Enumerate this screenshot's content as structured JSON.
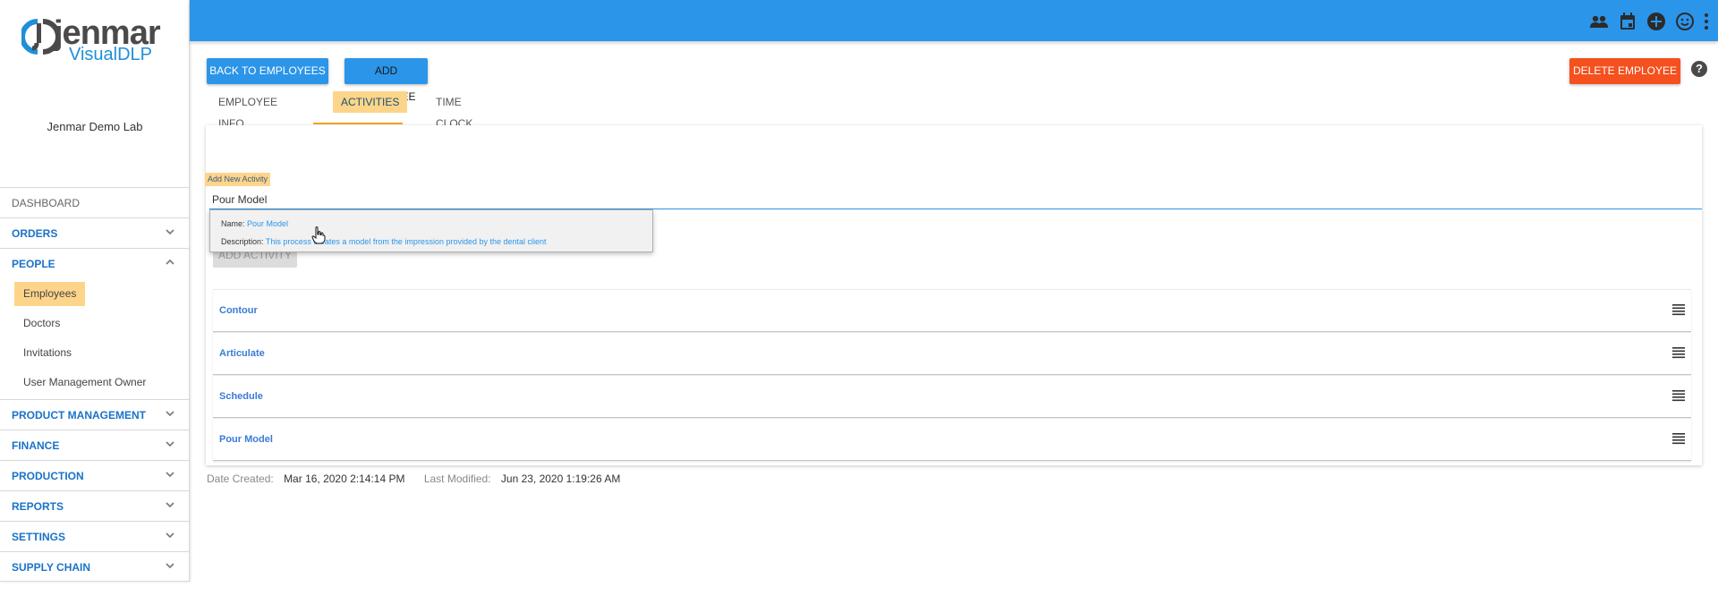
{
  "brand": {
    "name": "jenmar",
    "sub": "VisualDLP",
    "primary_color": "#2b95e9",
    "accent_color": "#fdd58a",
    "danger_color": "#f4511e"
  },
  "sidebar": {
    "org_name": "Jenmar Demo Lab",
    "dashboard": "DASHBOARD",
    "sections": {
      "orders": "ORDERS",
      "people": "PEOPLE",
      "product_management": "PRODUCT MANAGEMENT",
      "finance": "FINANCE",
      "production": "PRODUCTION",
      "reports": "REPORTS",
      "settings": "SETTINGS",
      "supply_chain": "SUPPLY CHAIN"
    },
    "people_items": [
      "Employees",
      "Doctors",
      "Invitations",
      "User Management Owner"
    ]
  },
  "topbar": {
    "icons": [
      "people-icon",
      "calendar-icon",
      "add-circle-icon",
      "smiley-icon",
      "more-vert-icon"
    ]
  },
  "toolbar": {
    "back_label": "BACK TO EMPLOYEES",
    "add_label": "ADD EMPLOYEE",
    "delete_label": "DELETE EMPLOYEE",
    "help_label": "?"
  },
  "tabs": [
    "EMPLOYEE INFO",
    "ACTIVITIES",
    "TIME CLOCK"
  ],
  "activity_form": {
    "label": "Add New Activity",
    "value": "Pour Model",
    "add_button": "ADD ACTIVITY"
  },
  "suggestion": {
    "name_key": "Name:",
    "name_value": "Pour Model",
    "desc_key": "Description:",
    "desc_value": "This process creates a model from the impression provided by the dental client"
  },
  "activities": [
    "Contour",
    "Articulate",
    "Schedule",
    "Pour Model"
  ],
  "meta": {
    "created_key": "Date Created:",
    "created_value": "Mar 16, 2020 2:14:14 PM",
    "modified_key": "Last Modified:",
    "modified_value": "Jun 23, 2020 1:19:26 AM"
  }
}
